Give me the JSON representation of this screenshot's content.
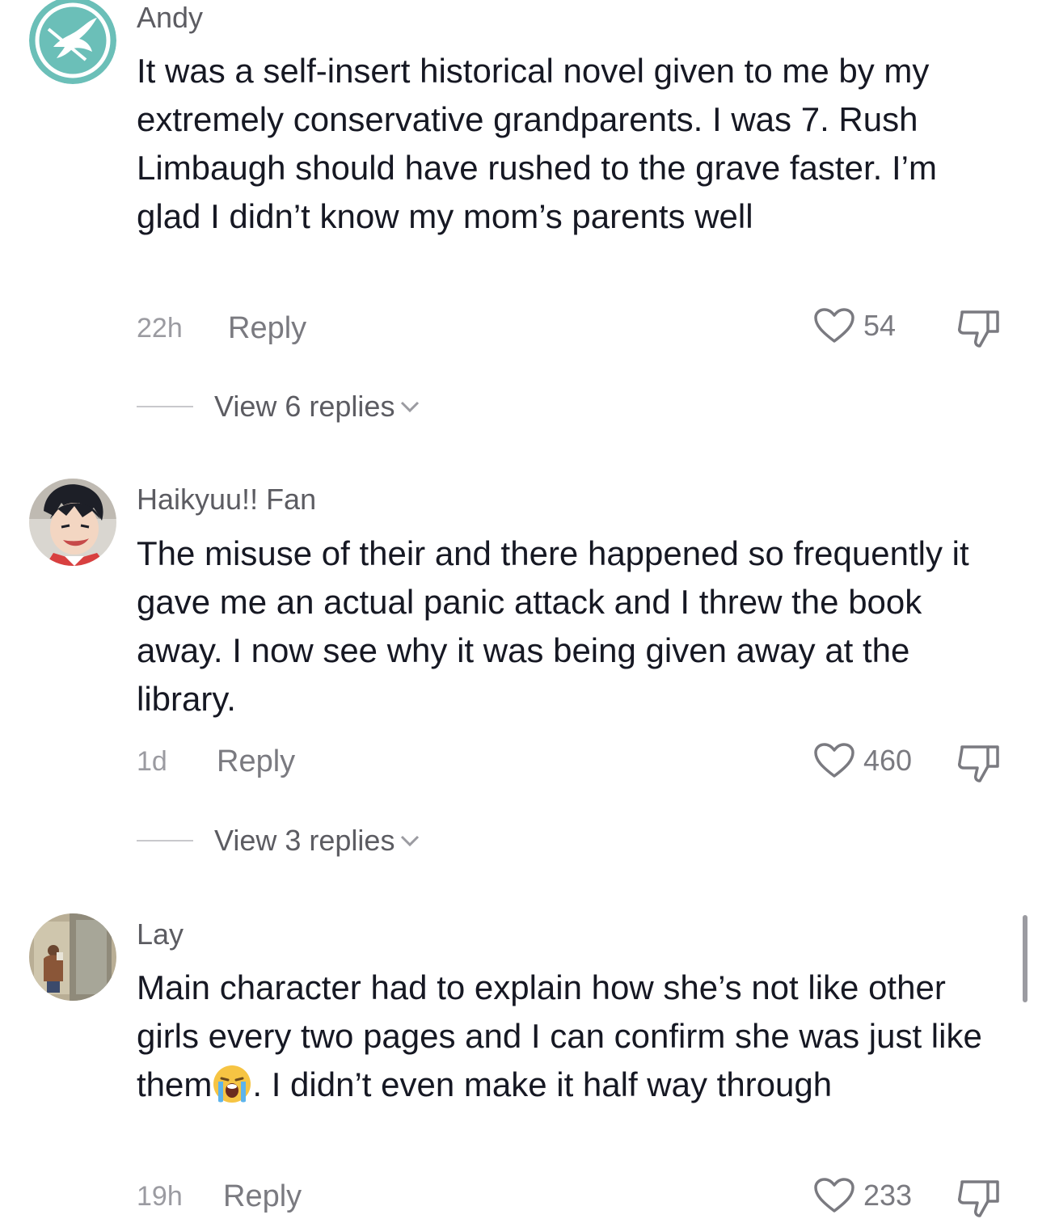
{
  "comments": [
    {
      "username": "Andy",
      "avatar_icon": "hunger-games-mockingjay-icon",
      "text": "It was a self-insert historical novel given to me by my extremely conservative grandparents. I was 7. Rush Limbaugh should have rushed to the grave faster. I’m glad I didn’t know my mom’s parents well",
      "time": "22h",
      "reply_label": "Reply",
      "likes": "54",
      "view_replies": "View 6 replies"
    },
    {
      "username": "Haikyuu!! Fan",
      "avatar_icon": "anime-character-avatar",
      "text": "The misuse of their and there happened so frequently it gave me an actual panic attack and I threw the book away. I now see why it was being given away at the library.",
      "time": "1d",
      "reply_label": "Reply",
      "likes": "460",
      "view_replies": "View 3 replies"
    },
    {
      "username": "Lay",
      "avatar_icon": "mirror-selfie-avatar",
      "text_before_emoji": "Main character had to explain how she’s not like other girls every two pages and I can confirm she was just like them",
      "emoji": "loudly-crying-face-emoji",
      "text_after_emoji": ". I didn’t even make it half way through",
      "time": "19h",
      "reply_label": "Reply",
      "likes": "233"
    }
  ],
  "colors": {
    "text": "#161823",
    "secondary": "#7a7a80",
    "avatar_andy": "#6bbfb8"
  }
}
